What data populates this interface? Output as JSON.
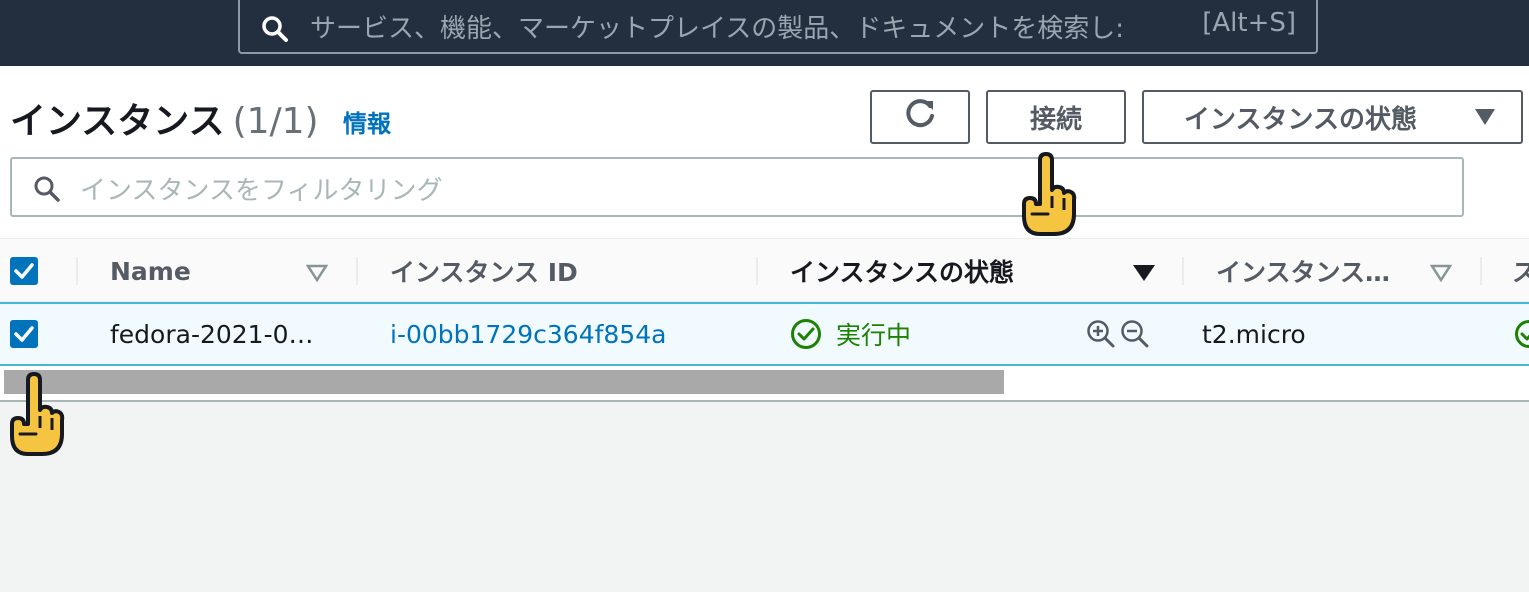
{
  "global_search": {
    "placeholder": "サービス、機能、マーケットプレイスの製品、ドキュメントを検索し:",
    "shortcut": "[Alt+S]"
  },
  "header": {
    "title": "インスタンス",
    "count": "(1/1)",
    "info_link": "情報"
  },
  "actions": {
    "connect_label": "接続",
    "state_label": "インスタンスの状態"
  },
  "filter": {
    "placeholder": "インスタンスをフィルタリング"
  },
  "table": {
    "columns": [
      "Name",
      "インスタンス ID",
      "インスタンスの状態",
      "インスタンス…",
      "ス"
    ],
    "rows": [
      {
        "name": "fedora-2021-0…",
        "instance_id": "i-00bb1729c364f854a",
        "state": "実行中",
        "type": "t2.micro"
      }
    ]
  },
  "colors": {
    "topbar": "#232f3e",
    "link": "#0073bb",
    "success": "#1d8102",
    "selected_row_border": "#44b9d6"
  }
}
